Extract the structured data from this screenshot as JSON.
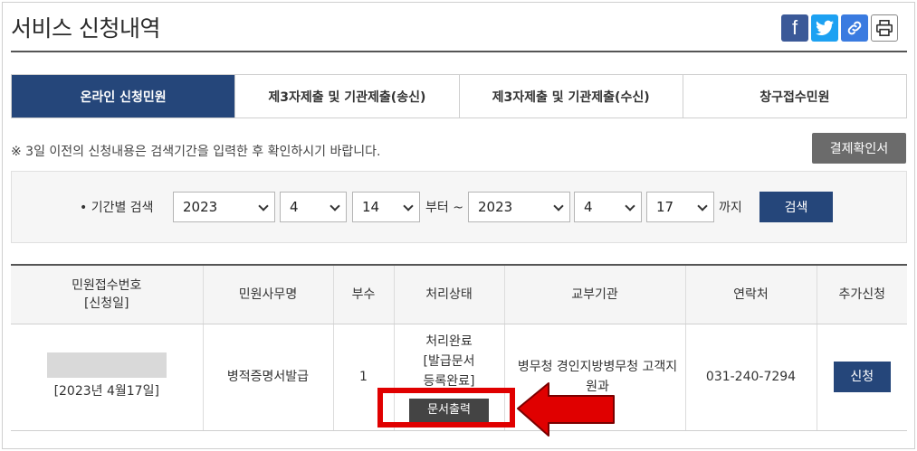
{
  "header": {
    "title": "서비스 신청내역",
    "share": {
      "facebook_glyph": "f"
    }
  },
  "tabs": [
    {
      "label": "온라인 신청민원",
      "active": true
    },
    {
      "label": "제3자제출 및 기관제출(송신)",
      "active": false
    },
    {
      "label": "제3자제출 및 기관제출(수신)",
      "active": false
    },
    {
      "label": "창구접수민원",
      "active": false
    }
  ],
  "notice": "※ 3일 이전의 신청내용은 검색기간을 입력한 후 확인하시기 바랍니다.",
  "payment_button": "결제확인서",
  "search": {
    "label": "• 기간별 검색",
    "from": {
      "year": "2023",
      "month": "4",
      "day": "14"
    },
    "from_suffix": "부터 ~",
    "to": {
      "year": "2023",
      "month": "4",
      "day": "17"
    },
    "to_suffix": "까지",
    "button": "검색"
  },
  "table": {
    "headers": {
      "receipt_no": "민원접수번호",
      "receipt_date": "[신청일]",
      "name": "민원사무명",
      "copies": "부수",
      "status": "처리상태",
      "agency": "교부기관",
      "contact": "연락처",
      "extra": "추가신청"
    },
    "rows": [
      {
        "date": "[2023년 4월17일]",
        "name": "병적증명서발급",
        "copies": "1",
        "status_line1": "처리완료",
        "status_line2": "[발급문서",
        "status_line3": "등록완료]",
        "print_button": "문서출력",
        "agency": "병무청 경인지방병무청 고객지원과",
        "contact": "031-240-7294",
        "apply_button": "신청"
      }
    ]
  },
  "colors": {
    "primary": "#25467a",
    "highlight": "#e00000",
    "facebook": "#3b5998",
    "twitter": "#1da1f2"
  }
}
